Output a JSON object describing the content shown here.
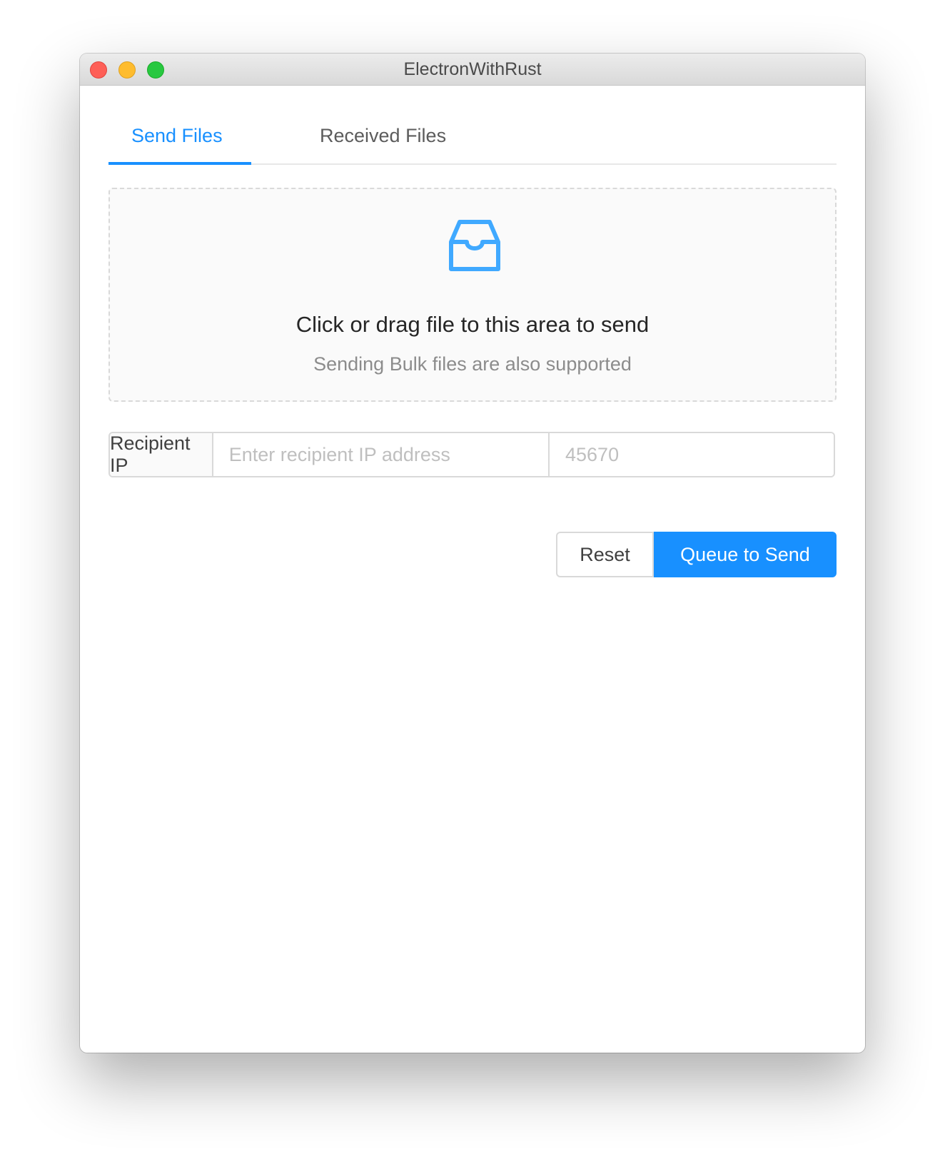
{
  "window": {
    "title": "ElectronWithRust"
  },
  "tabs": [
    {
      "label": "Send Files",
      "active": true
    },
    {
      "label": "Received Files",
      "active": false
    }
  ],
  "dropzone": {
    "icon": "inbox-icon",
    "text": "Click or drag file to this area to send",
    "hint": "Sending Bulk files are also supported"
  },
  "recipient": {
    "addon_label": "Recipient IP",
    "ip_placeholder": "Enter recipient IP address",
    "ip_value": "",
    "port_placeholder": "45670",
    "port_value": ""
  },
  "actions": {
    "reset_label": "Reset",
    "queue_label": "Queue to Send"
  },
  "colors": {
    "accent": "#1890ff",
    "close": "#fe5f57",
    "minimize": "#febc2e",
    "zoom": "#28c840"
  }
}
